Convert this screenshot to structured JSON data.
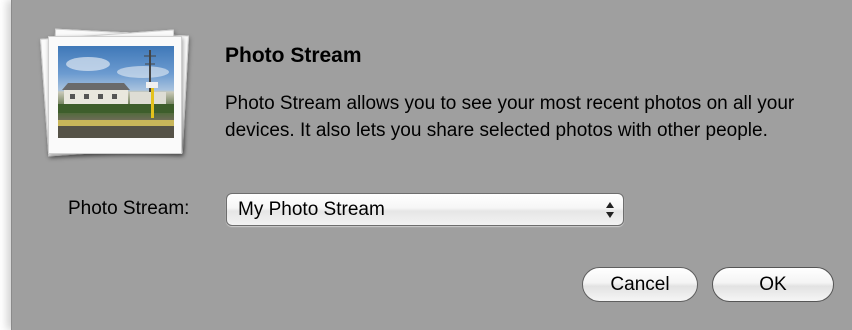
{
  "dialog": {
    "title": "Photo Stream",
    "description": "Photo Stream allows you to see your most recent photos on all your devices. It also lets you share selected photos with other people.",
    "icon": "photo-stack-icon"
  },
  "stream_select": {
    "label": "Photo Stream:",
    "selected_value": "My Photo Stream"
  },
  "buttons": {
    "cancel_label": "Cancel",
    "ok_label": "OK"
  },
  "colors": {
    "sheet_background": "#9f9f9f",
    "button_top": "#ffffff",
    "button_bottom": "#e2e2e2"
  }
}
